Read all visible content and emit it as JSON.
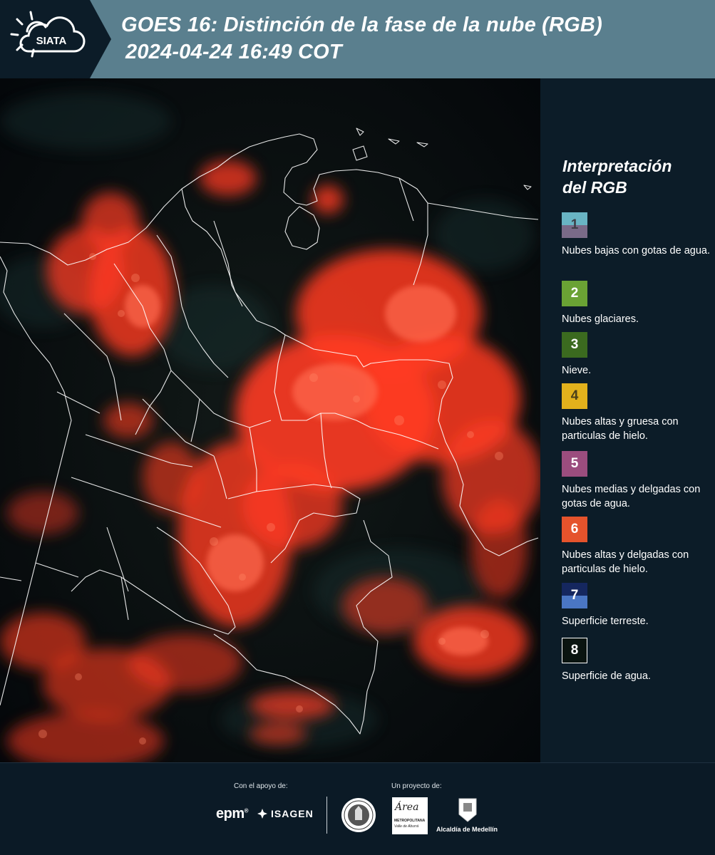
{
  "header": {
    "logo_text": "SIATA",
    "title_line1": "GOES 16: Distinción de la fase de la nube (RGB)",
    "title_line2": "2024-04-24 16:49 COT"
  },
  "legend": {
    "title_line1": "Interpretación",
    "title_line2": "del RGB",
    "items": [
      {
        "number": "1",
        "label": "Nubes bajas con gotas de agua.",
        "color_top": "#69b4c4",
        "color_bottom": "#7a6a88",
        "text_color": "#3e3e46"
      },
      {
        "number": "2",
        "label": "Nubes glaciares.",
        "color_top": "#6aa234",
        "color_bottom": "#6aa234",
        "text_color": "#ffffff"
      },
      {
        "number": "3",
        "label": "Nieve.",
        "color_top": "#3b6a1f",
        "color_bottom": "#3b6a1f",
        "text_color": "#ffffff"
      },
      {
        "number": "4",
        "label": "Nubes altas y gruesa con particulas de hielo.",
        "color_top": "#e2b11c",
        "color_bottom": "#e2b11c",
        "text_color": "#4a3f1a"
      },
      {
        "number": "5",
        "label": "Nubes medias y delgadas con gotas de agua.",
        "color_top": "#9b4d7e",
        "color_bottom": "#9b4d7e",
        "text_color": "#ffffff"
      },
      {
        "number": "6",
        "label": "Nubes altas y delgadas con particulas de hielo.",
        "color_top": "#e5532c",
        "color_bottom": "#e5532c",
        "text_color": "#ffffff"
      },
      {
        "number": "7",
        "label": "Superficie terreste.",
        "color_top": "#15275f",
        "color_bottom": "#4a76c4",
        "text_color": "#ffffff"
      },
      {
        "number": "8",
        "label": "Superficie de agua.",
        "color_top": "#0a1410",
        "color_bottom": "#0a1410",
        "text_color": "#ffffff"
      }
    ]
  },
  "footer": {
    "support_label": "Con el apoyo de:",
    "project_label": "Un proyecto de:",
    "epm": "epm",
    "isagen": "ISAGEN",
    "area_text": "Área",
    "area_subtitle": "METROPOLITANA",
    "area_subtitle2": "Valle de Aburrá",
    "alcaldia": "Alcaldía de Medellín"
  },
  "colors": {
    "header_bg": "#5a7f8e",
    "panel_bg": "#0c1c28",
    "cloud_red": "#ff3b22",
    "border_white": "#ffffff"
  }
}
